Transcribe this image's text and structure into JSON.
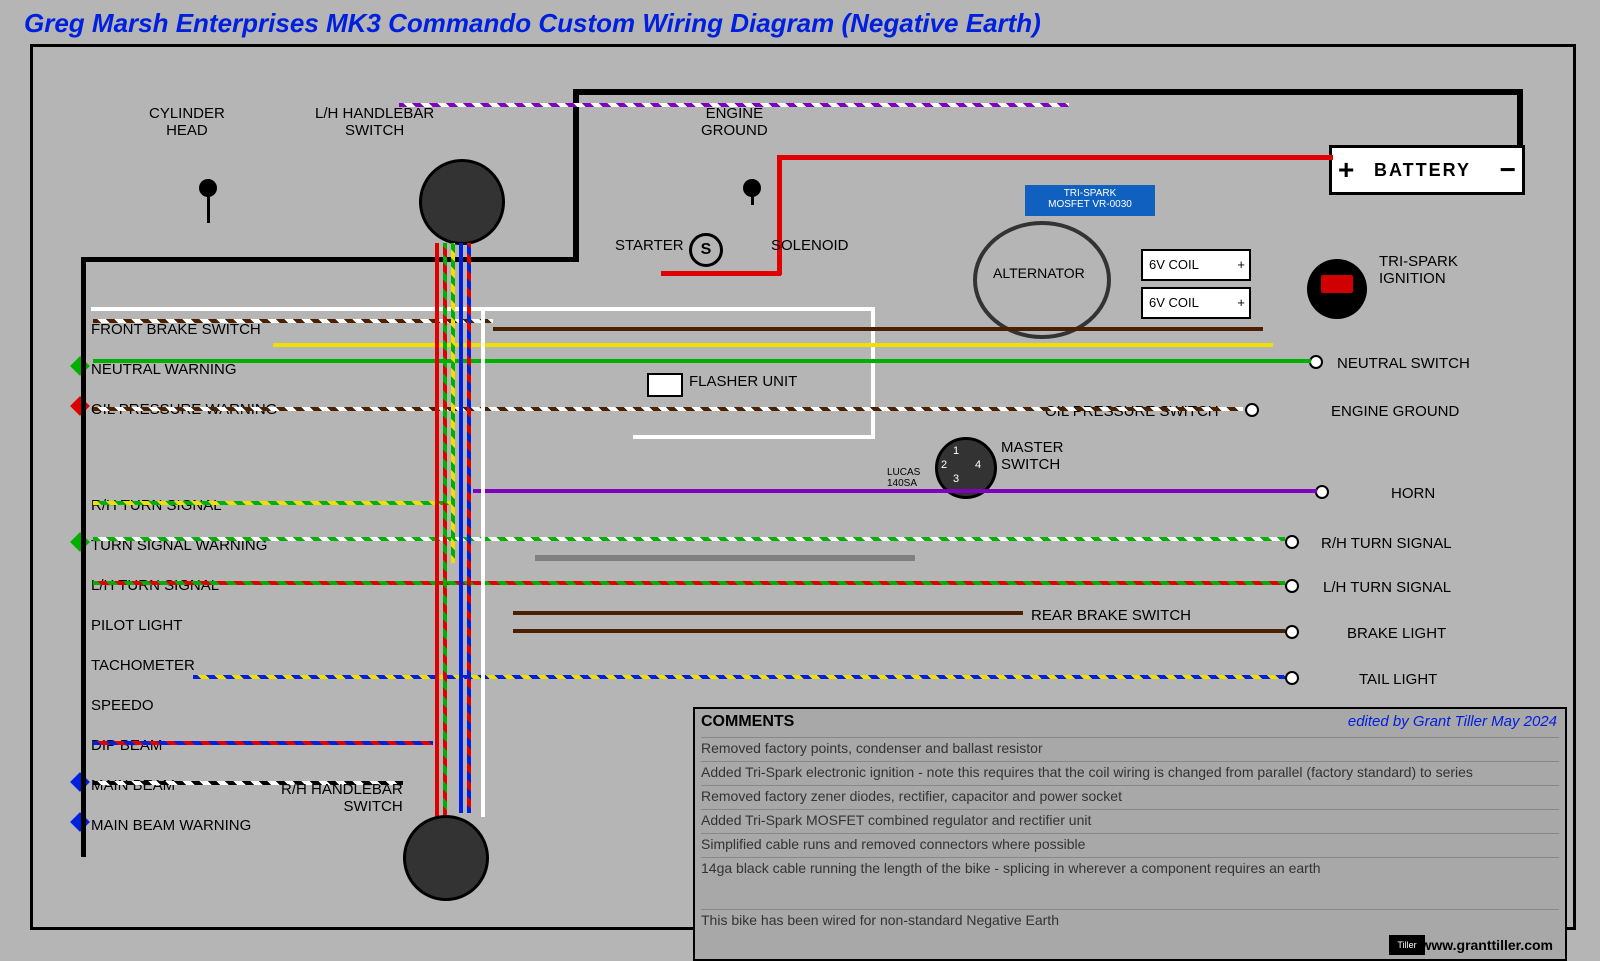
{
  "title": "Greg Marsh Enterprises MK3 Commando Custom Wiring Diagram (Negative Earth)",
  "components": {
    "cylinder_head": "CYLINDER\nHEAD",
    "lh_handlebar": "L/H HANDLEBAR\nSWITCH",
    "rh_handlebar": "R/H HANDLEBAR\nSWITCH",
    "engine_ground_top": "ENGINE\nGROUND",
    "starter": "STARTER",
    "starter_letter": "S",
    "solenoid": "SOLENOID",
    "mosfet_l1": "TRI-SPARK",
    "mosfet_l2": "MOSFET VR-0030",
    "alternator": "ALTERNATOR",
    "coil1": "6V COIL",
    "coil2": "6V COIL",
    "ignition": "TRI-SPARK\nIGNITION",
    "battery": "BATTERY",
    "flasher": "FLASHER UNIT",
    "master_switch": "MASTER\nSWITCH",
    "lucas": "LUCAS\n140SA",
    "oil_pressure_switch": "OIL PRESSURE SWITCH",
    "rear_brake_switch": "REAR BRAKE SWITCH",
    "neutral_switch": "NEUTRAL  SWITCH",
    "engine_ground_right": "ENGINE GROUND",
    "horn": "HORN",
    "rh_turn_signal_r": "R/H TURN SIGNAL",
    "lh_turn_signal_r": "L/H TURN SIGNAL",
    "brake_light": "BRAKE LIGHT",
    "tail_light": "TAIL LIGHT",
    "ms_1": "1",
    "ms_2": "2",
    "ms_3": "3",
    "ms_4": "4",
    "plus": "+",
    "minus": "−"
  },
  "left_column": {
    "front_brake_switch": "FRONT BRAKE SWITCH",
    "neutral_warning": "NEUTRAL WARNING",
    "oil_pressure_warning": "OIL PRESSURE WARNING",
    "rh_turn_signal": "R/H TURN SIGNAL",
    "turn_signal_warning": "TURN SIGNAL WARNING",
    "lh_turn_signal": "L/H TURN SIGNAL",
    "pilot_light": "PILOT LIGHT",
    "tachometer": "TACHOMETER",
    "speedo": "SPEEDO",
    "dip_beam": "DIP BEAM",
    "main_beam": "MAIN BEAM",
    "main_beam_warning": "MAIN BEAM WARNING"
  },
  "comments": {
    "heading": "COMMENTS",
    "edited": "edited by Grant Tiller May 2024",
    "lines": [
      "Removed factory points, condenser and ballast resistor",
      "Added Tri-Spark electronic ignition - note this requires that the coil wiring is changed from parallel (factory standard) to series",
      "Removed factory zener diodes, rectifier, capacitor and power socket",
      "Added Tri-Spark MOSFET combined regulator and rectifier unit",
      "Simplified cable runs and removed connectors where possible",
      "14ga black cable running the length of the bike - splicing in wherever a component requires an earth",
      "This bike has been wired for non-standard Negative Earth"
    ]
  },
  "footer": {
    "logo": "Tiller",
    "url": "www.granttiller.com"
  }
}
